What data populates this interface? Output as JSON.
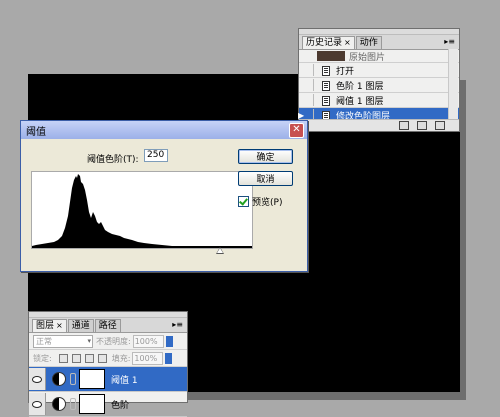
{
  "history_panel": {
    "tabs": [
      {
        "label": "历史记录",
        "close": "×"
      },
      {
        "label": "动作"
      }
    ],
    "snapshot_label": "原始图片",
    "items": [
      {
        "label": "打开"
      },
      {
        "label": "色阶 1 图层"
      },
      {
        "label": "阈值 1 图层"
      },
      {
        "label": "修改色阶图层"
      }
    ],
    "selected_index": 3
  },
  "threshold_dialog": {
    "title": "阈值",
    "level_label": "阈值色阶(T):",
    "level_value": "250",
    "ok_label": "确定",
    "cancel_label": "取消",
    "preview_label": "预览(P)",
    "preview_checked": true
  },
  "layers_panel": {
    "tabs": [
      {
        "label": "图层",
        "close": "×"
      },
      {
        "label": "通道"
      },
      {
        "label": "路径"
      }
    ],
    "blend_mode": "正常",
    "opacity_label": "不透明度:",
    "opacity_value": "100%",
    "lock_label": "锁定:",
    "fill_label": "填充:",
    "fill_value": "100%",
    "layers": [
      {
        "name": "阈值 1",
        "selected": true
      },
      {
        "name": "色阶"
      }
    ]
  },
  "colors": {
    "selection": "#316ac5",
    "dialog_bg": "#ece9d8"
  }
}
